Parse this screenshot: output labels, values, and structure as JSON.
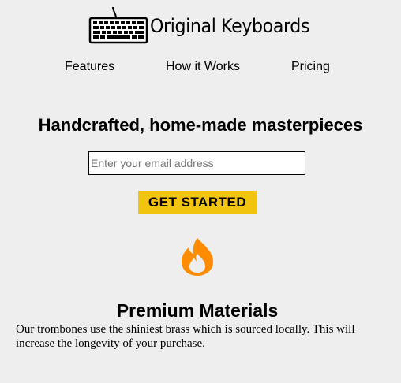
{
  "header": {
    "logo_icon": "keyboard-icon",
    "logo_text": "Original Keyboards"
  },
  "nav": {
    "items": [
      {
        "label": "Features"
      },
      {
        "label": "How it Works"
      },
      {
        "label": "Pricing"
      }
    ]
  },
  "hero": {
    "title": "Handcrafted, home-made masterpieces",
    "email_placeholder": "Enter your email address",
    "cta_label": "GET STARTED"
  },
  "features": [
    {
      "icon": "fire-icon",
      "title": "Premium Materials",
      "description": "Our trombones use the shiniest brass which is sourced locally. This will increase the longevity of your purchase."
    }
  ],
  "colors": {
    "background": "#eeeeee",
    "cta": "#f1c40f",
    "flame": "#ff8c00"
  }
}
